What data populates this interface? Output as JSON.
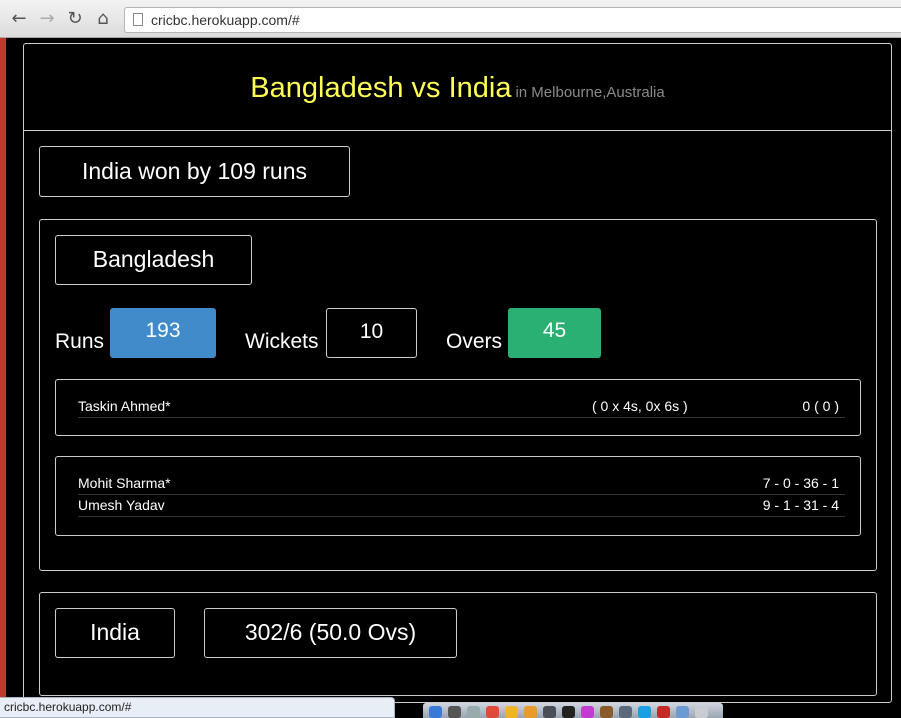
{
  "browser": {
    "url": "cricbc.herokuapp.com/#",
    "status_url": "cricbc.herokuapp.com/#",
    "icons": {
      "back": "back-arrow-icon",
      "forward": "forward-arrow-icon",
      "reload": "reload-icon",
      "home": "home-icon",
      "page": "page-icon"
    }
  },
  "match": {
    "title": "Bangladesh vs India",
    "venue": "in Melbourne,Australia",
    "result": "India won by 109 runs"
  },
  "innings1": {
    "team": "Bangladesh",
    "runs_label": "Runs",
    "runs": "193",
    "wickets_label": "Wickets",
    "wickets": "10",
    "overs_label": "Overs",
    "overs": "45",
    "batsmen": [
      {
        "name": "Taskin Ahmed*",
        "boundaries": "( 0 x 4s, 0x 6s )",
        "score": "0 ( 0 )"
      }
    ],
    "bowlers": [
      {
        "name": "Mohit Sharma*",
        "figures": "7 - 0 - 36 - 1"
      },
      {
        "name": "Umesh Yadav",
        "figures": "9 - 1 - 31 - 4"
      }
    ]
  },
  "innings2": {
    "team": "India",
    "score": "302/6 (50.0 Ovs)"
  },
  "colors": {
    "title": "#ffff55",
    "venue": "#8a8a8a",
    "runs_bg": "#428bca",
    "overs_bg": "#2bb073"
  }
}
